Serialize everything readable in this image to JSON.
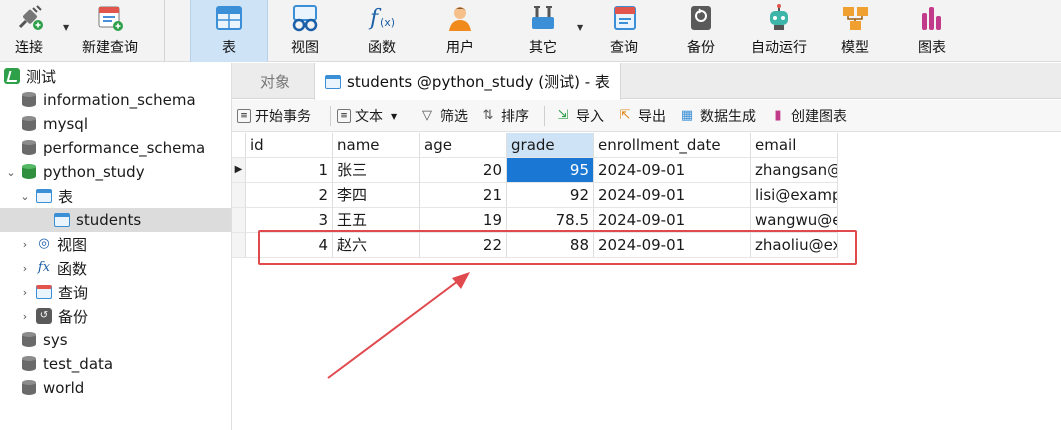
{
  "toolbar": {
    "connect": "连接",
    "new_query": "新建查询",
    "table": "表",
    "view": "视图",
    "function": "函数",
    "user": "用户",
    "other": "其它",
    "query": "查询",
    "backup": "备份",
    "automation": "自动运行",
    "model": "模型",
    "chart": "图表"
  },
  "sidebar": {
    "connection": "测试",
    "databases": [
      "information_schema",
      "mysql",
      "performance_schema",
      "python_study"
    ],
    "tables_group": "表",
    "table_students": "students",
    "views": "视图",
    "functions": "函数",
    "queries": "查询",
    "backups": "备份",
    "other_dbs": [
      "sys",
      "test_data",
      "world"
    ]
  },
  "tabs": {
    "objects": "对象",
    "active": "students @python_study (测试) - 表"
  },
  "subbar": {
    "begin_tx": "开始事务",
    "text": "文本",
    "filter": "筛选",
    "sort": "排序",
    "import": "导入",
    "export": "导出",
    "data_gen": "数据生成",
    "create_chart": "创建图表"
  },
  "grid": {
    "columns": [
      "id",
      "name",
      "age",
      "grade",
      "enrollment_date",
      "email"
    ],
    "rows": [
      [
        "1",
        "张三",
        "20",
        "95",
        "2024-09-01",
        "zhangsan@e"
      ],
      [
        "2",
        "李四",
        "21",
        "92",
        "2024-09-01",
        "lisi@examp"
      ],
      [
        "3",
        "王五",
        "19",
        "78.5",
        "2024-09-01",
        "wangwu@e"
      ],
      [
        "4",
        "赵六",
        "22",
        "88",
        "2024-09-01",
        "zhaoliu@ex"
      ]
    ]
  },
  "colors": {
    "accent": "#1a78d4",
    "annotation": "#e0494d"
  }
}
